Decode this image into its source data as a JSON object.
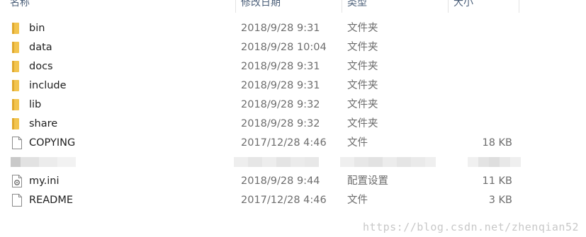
{
  "header": {
    "name": "名称",
    "date": "修改日期",
    "type": "类型",
    "size": "大小"
  },
  "rows": [
    {
      "name": "bin",
      "date": "2018/9/28 9:31",
      "type": "文件夹",
      "size": "",
      "icon": "folder-icon"
    },
    {
      "name": "data",
      "date": "2018/9/28 10:04",
      "type": "文件夹",
      "size": "",
      "icon": "folder-icon"
    },
    {
      "name": "docs",
      "date": "2018/9/28 9:31",
      "type": "文件夹",
      "size": "",
      "icon": "folder-icon"
    },
    {
      "name": "include",
      "date": "2018/9/28 9:31",
      "type": "文件夹",
      "size": "",
      "icon": "folder-icon"
    },
    {
      "name": "lib",
      "date": "2018/9/28 9:32",
      "type": "文件夹",
      "size": "",
      "icon": "folder-icon"
    },
    {
      "name": "share",
      "date": "2018/9/28 9:32",
      "type": "文件夹",
      "size": "",
      "icon": "folder-icon"
    },
    {
      "name": "COPYING",
      "date": "2017/12/28 4:46",
      "type": "文件",
      "size": "18 KB",
      "icon": "file-icon"
    },
    {
      "name": "my.ini",
      "date": "2018/9/28 9:44",
      "type": "配置设置",
      "size": "11 KB",
      "icon": "config-file-icon"
    },
    {
      "name": "README",
      "date": "2017/12/28 4:46",
      "type": "文件",
      "size": "3 KB",
      "icon": "file-icon"
    }
  ],
  "watermark": "https://blog.csdn.net/zhenqian52",
  "colors": {
    "folder": "#f2c44f",
    "header_text": "#4c607a",
    "secondary_text": "#6d6d6d"
  }
}
